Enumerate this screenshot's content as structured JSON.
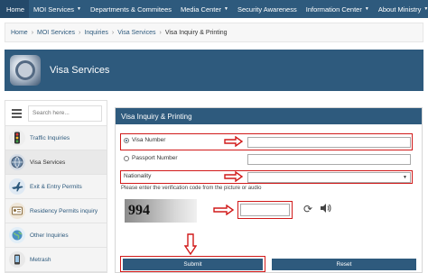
{
  "nav": {
    "items": [
      {
        "label": "Home",
        "dropdown": false
      },
      {
        "label": "MOI Services",
        "dropdown": true
      },
      {
        "label": "Departments & Commitees",
        "dropdown": false
      },
      {
        "label": "Media Center",
        "dropdown": true
      },
      {
        "label": "Security Awareness",
        "dropdown": false
      },
      {
        "label": "Information Center",
        "dropdown": true
      },
      {
        "label": "About Ministry",
        "dropdown": true
      }
    ]
  },
  "breadcrumb": [
    "Home",
    "MOI Services",
    "Inquiries",
    "Visa Services",
    "Visa Inquiry & Printing"
  ],
  "page": {
    "title": "Visa Services"
  },
  "sidebar": {
    "search_placeholder": "Search here...",
    "items": [
      {
        "label": "Traffic Inquiries",
        "icon": "traffic-light-icon"
      },
      {
        "label": "Visa Services",
        "icon": "visa-globe-icon"
      },
      {
        "label": "Exit & Entry Permits",
        "icon": "airplane-icon"
      },
      {
        "label": "Residency Permits inquiry",
        "icon": "residency-card-icon"
      },
      {
        "label": "Other Inquiries",
        "icon": "globe-icon"
      },
      {
        "label": "Metrash",
        "icon": "phone-icon"
      }
    ]
  },
  "form": {
    "title": "Visa Inquiry & Printing",
    "visa_number_label": "Visa Number",
    "passport_number_label": "Passport Number",
    "nationality_label": "Nationality",
    "verification_note": "Please enter the verification code from the picture or audio",
    "captcha_text": "994",
    "submit_label": "Submit",
    "reset_label": "Reset"
  },
  "colors": {
    "primary": "#2e5a7d",
    "highlight": "#d11a1a"
  }
}
